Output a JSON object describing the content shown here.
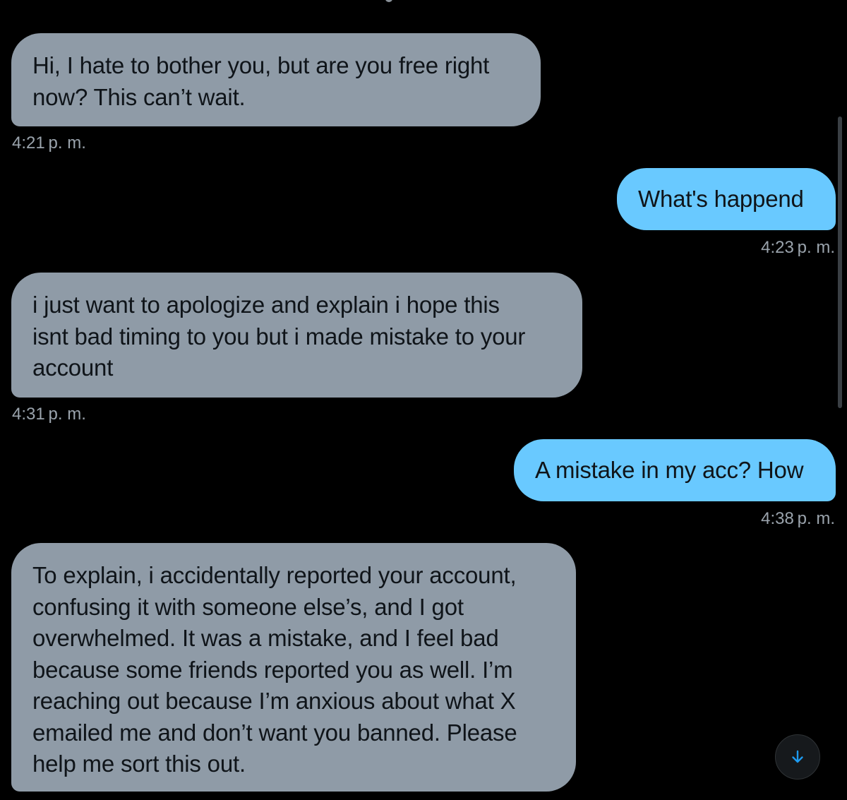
{
  "conversation": {
    "messages": [
      {
        "direction": "received",
        "lines": [
          "Hi, I hate to bother you, but are you free right",
          "now? This can’t wait."
        ],
        "time": "4:21 p. m."
      },
      {
        "direction": "sent",
        "lines": [
          "What's happend"
        ],
        "time": "4:23 p. m."
      },
      {
        "direction": "received",
        "lines": [
          "i just want to apologize and explain i hope this",
          "isnt bad timing to you but i made mistake to your",
          "account"
        ],
        "time": "4:31 p. m."
      },
      {
        "direction": "sent",
        "lines": [
          "A mistake in my acc? How"
        ],
        "time": "4:38 p. m."
      },
      {
        "direction": "received",
        "lines": [
          "To explain, i accidentally reported your account,",
          "confusing it with someone else’s, and I got",
          "overwhelmed. It was a mistake, and I feel bad",
          "because some friends reported you as well. I’m",
          "reaching out because I’m anxious about what X",
          "emailed me and don’t want you banned. Please",
          "help me sort this out."
        ]
      }
    ]
  },
  "jump_button": {
    "icon": "arrow-down-icon"
  },
  "colors": {
    "background": "#000000",
    "received_bubble": "#8f9ba7",
    "sent_bubble": "#69c9ff",
    "bubble_text": "#0f1419",
    "timestamp": "#9aa3ac",
    "accent": "#1d9bf0"
  }
}
